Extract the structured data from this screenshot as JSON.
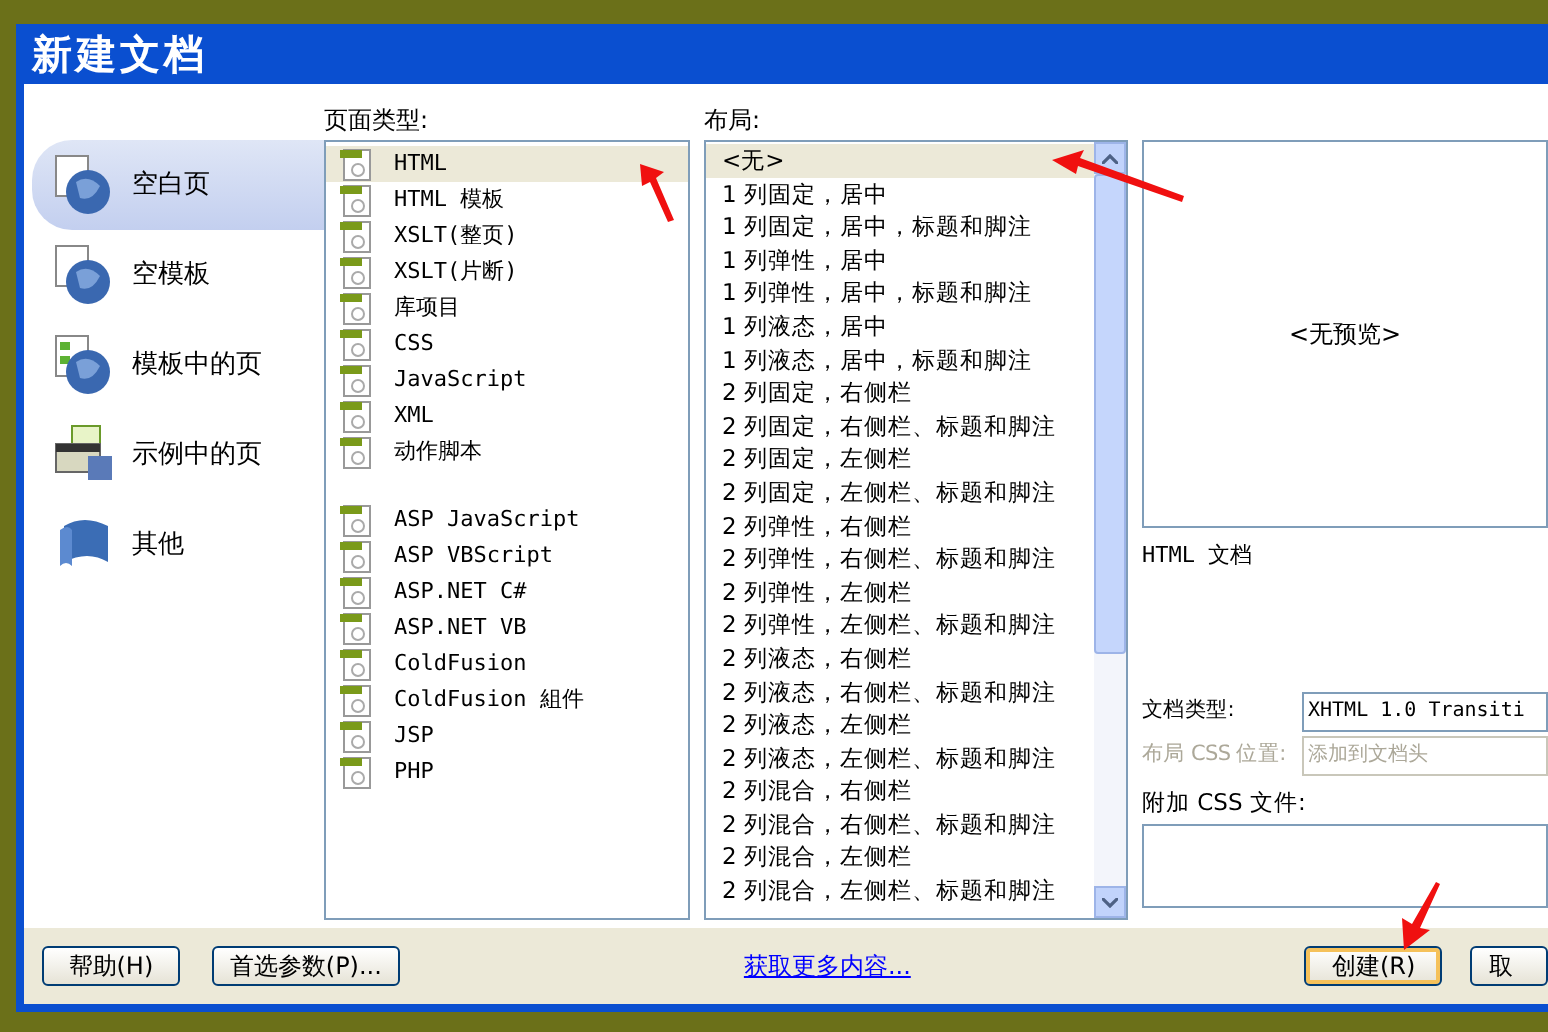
{
  "window": {
    "title": "新建文档"
  },
  "categories": [
    {
      "label": "空白页",
      "selected": true
    },
    {
      "label": "空模板",
      "selected": false
    },
    {
      "label": "模板中的页",
      "selected": false
    },
    {
      "label": "示例中的页",
      "selected": false
    },
    {
      "label": "其他",
      "selected": false
    }
  ],
  "page_type": {
    "label": "页面类型:",
    "groups": [
      [
        {
          "label": "HTML",
          "selected": true
        },
        {
          "label": "HTML 模板",
          "selected": false
        },
        {
          "label": "XSLT(整页)",
          "selected": false
        },
        {
          "label": "XSLT(片断)",
          "selected": false
        },
        {
          "label": "库项目",
          "selected": false
        },
        {
          "label": "CSS",
          "selected": false
        },
        {
          "label": "JavaScript",
          "selected": false
        },
        {
          "label": "XML",
          "selected": false
        },
        {
          "label": "动作脚本",
          "selected": false
        }
      ],
      [
        {
          "label": "ASP JavaScript",
          "selected": false
        },
        {
          "label": "ASP VBScript",
          "selected": false
        },
        {
          "label": "ASP.NET C#",
          "selected": false
        },
        {
          "label": "ASP.NET VB",
          "selected": false
        },
        {
          "label": "ColdFusion",
          "selected": false
        },
        {
          "label": "ColdFusion 組件",
          "selected": false
        },
        {
          "label": "JSP",
          "selected": false
        },
        {
          "label": "PHP",
          "selected": false
        }
      ]
    ]
  },
  "layout": {
    "label": "布局:",
    "items": [
      {
        "label": "<无>",
        "selected": true
      },
      {
        "label": "1 列固定，居中",
        "selected": false
      },
      {
        "label": "1 列固定，居中，标题和脚注",
        "selected": false
      },
      {
        "label": "1 列弹性，居中",
        "selected": false
      },
      {
        "label": "1 列弹性，居中，标题和脚注",
        "selected": false
      },
      {
        "label": "1 列液态，居中",
        "selected": false
      },
      {
        "label": "1 列液态，居中，标题和脚注",
        "selected": false
      },
      {
        "label": "2 列固定，右侧栏",
        "selected": false
      },
      {
        "label": "2 列固定，右侧栏、标题和脚注",
        "selected": false
      },
      {
        "label": "2 列固定，左侧栏",
        "selected": false
      },
      {
        "label": "2 列固定，左侧栏、标题和脚注",
        "selected": false
      },
      {
        "label": "2 列弹性，右侧栏",
        "selected": false
      },
      {
        "label": "2 列弹性，右侧栏、标题和脚注",
        "selected": false
      },
      {
        "label": "2 列弹性，左侧栏",
        "selected": false
      },
      {
        "label": "2 列弹性，左侧栏、标题和脚注",
        "selected": false
      },
      {
        "label": "2 列液态，右侧栏",
        "selected": false
      },
      {
        "label": "2 列液态，右侧栏、标题和脚注",
        "selected": false
      },
      {
        "label": "2 列液态，左侧栏",
        "selected": false
      },
      {
        "label": "2 列液态，左侧栏、标题和脚注",
        "selected": false
      },
      {
        "label": "2 列混合，右侧栏",
        "selected": false
      },
      {
        "label": "2 列混合，右侧栏、标题和脚注",
        "selected": false
      },
      {
        "label": "2 列混合，左侧栏",
        "selected": false
      },
      {
        "label": "2 列混合，左侧栏、标题和脚注",
        "selected": false
      }
    ]
  },
  "preview": {
    "text": "<无预览>",
    "description": "HTML 文档"
  },
  "doc_type": {
    "label": "文档类型:",
    "value": "XHTML 1.0 Transiti"
  },
  "css_location": {
    "label": "布局 CSS 位置:",
    "value": "添加到文档头",
    "disabled": true
  },
  "attach_css": {
    "label": "附加 CSS 文件:"
  },
  "footer": {
    "help": "帮助(H)",
    "prefs": "首选参数(P)...",
    "link": "获取更多内容...",
    "create": "创建(R)",
    "cancel": "取"
  }
}
